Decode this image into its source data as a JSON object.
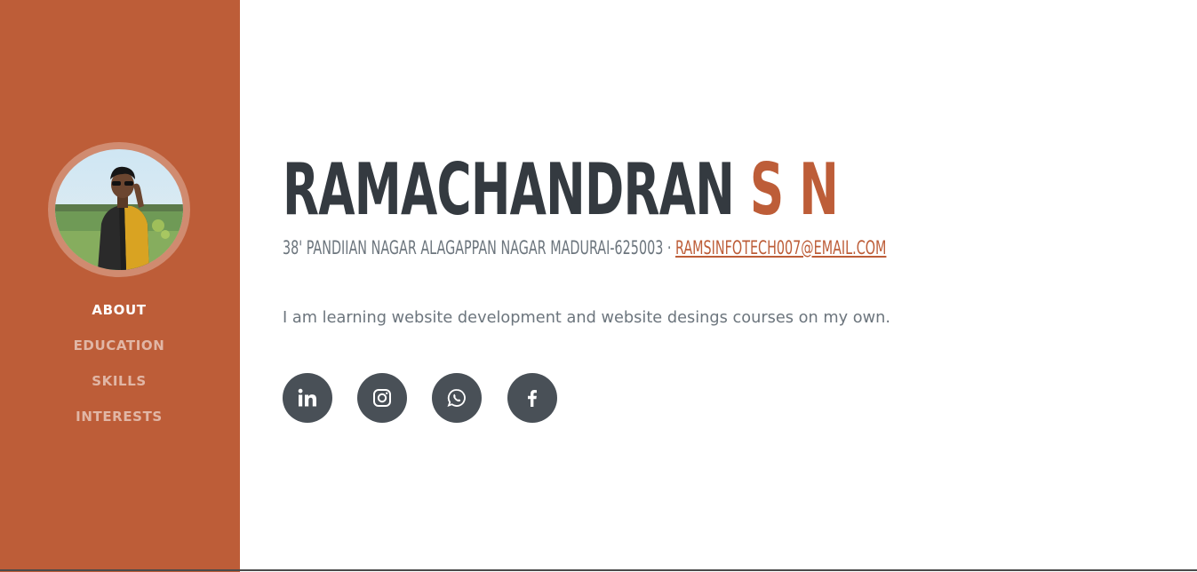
{
  "profile": {
    "photo_alt": "profile-photo"
  },
  "nav": {
    "items": [
      {
        "label": "ABOUT",
        "active": true
      },
      {
        "label": "EDUCATION",
        "active": false
      },
      {
        "label": "SKILLS",
        "active": false
      },
      {
        "label": "INTERESTS",
        "active": false
      }
    ]
  },
  "about": {
    "first_name": "RAMACHANDRAN",
    "last_name": "S N",
    "address": "38' PANDIIAN NAGAR ALAGAPPAN NAGAR MADURAI-625003 ·",
    "email": "RAMSINFOTECH007@EMAIL.COM",
    "intro": "I am learning website development and website desings courses on my own."
  },
  "social": [
    {
      "name": "linkedin-icon"
    },
    {
      "name": "instagram-icon"
    },
    {
      "name": "whatsapp-icon"
    },
    {
      "name": "facebook-icon"
    }
  ],
  "colors": {
    "sidebar": "#bd5d38",
    "accent": "#bd5d38",
    "heading": "#343a40",
    "text": "#6c757d",
    "social_bg": "#495057"
  }
}
